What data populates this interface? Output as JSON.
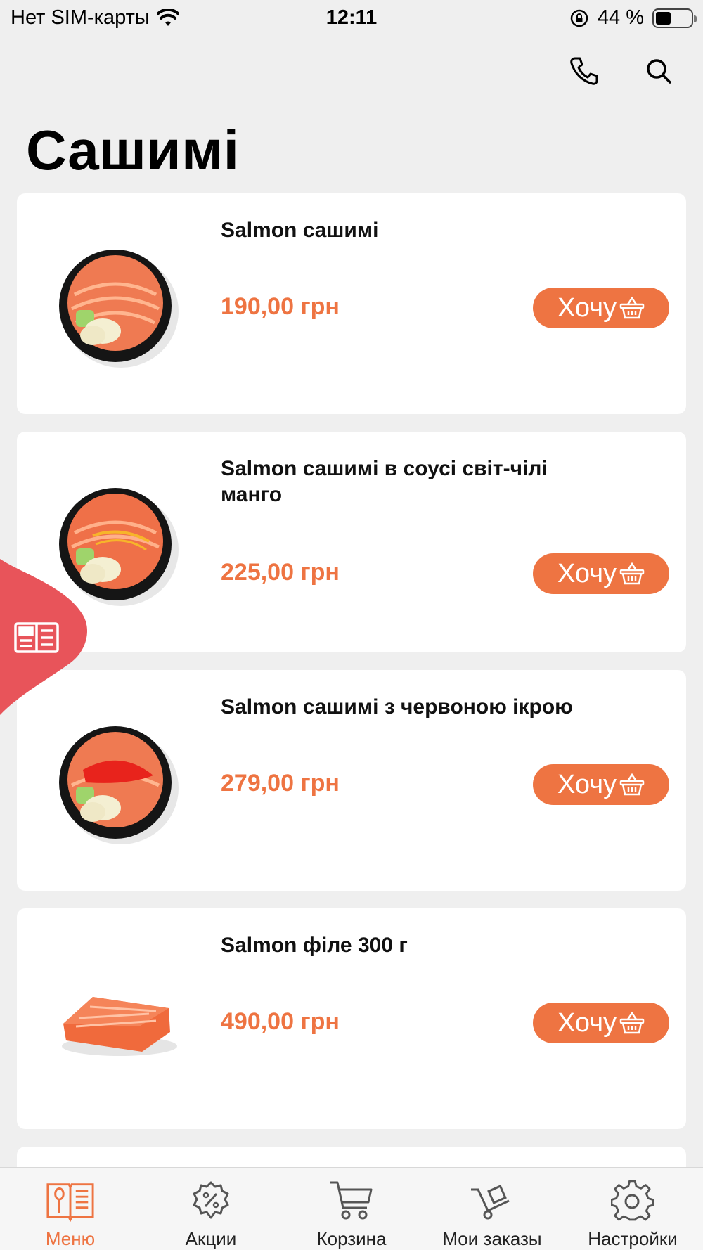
{
  "status_bar": {
    "carrier": "Нет SIM-карты",
    "time": "12:11",
    "battery": "44 %",
    "battery_level": 0.44
  },
  "header": {
    "title": "Сашимі",
    "phone_icon": "phone-icon",
    "search_icon": "search-icon"
  },
  "products": [
    {
      "name": "Salmon сашимі",
      "price": "190,00 грн",
      "button": "Хочу"
    },
    {
      "name": "Salmon сашимі в соусі світ-чілі манго",
      "price": "225,00 грн",
      "button": "Хочу"
    },
    {
      "name": "Salmon сашимі з червоною ікрою",
      "price": "279,00 грн",
      "button": "Хочу"
    },
    {
      "name": "Salmon філе 300 г",
      "price": "490,00 грн",
      "button": "Хочу"
    }
  ],
  "bottom_nav": [
    {
      "label": "Меню",
      "icon": "menu-book-icon",
      "active": true
    },
    {
      "label": "Акции",
      "icon": "promo-gear-icon",
      "active": false
    },
    {
      "label": "Корзина",
      "icon": "cart-icon",
      "active": false
    },
    {
      "label": "Мои заказы",
      "icon": "delivery-cart-icon",
      "active": false
    },
    {
      "label": "Настройки",
      "icon": "settings-gear-icon",
      "active": false
    }
  ],
  "colors": {
    "accent": "#ee7442",
    "side_tab": "#e8545a",
    "background": "#efefef"
  }
}
